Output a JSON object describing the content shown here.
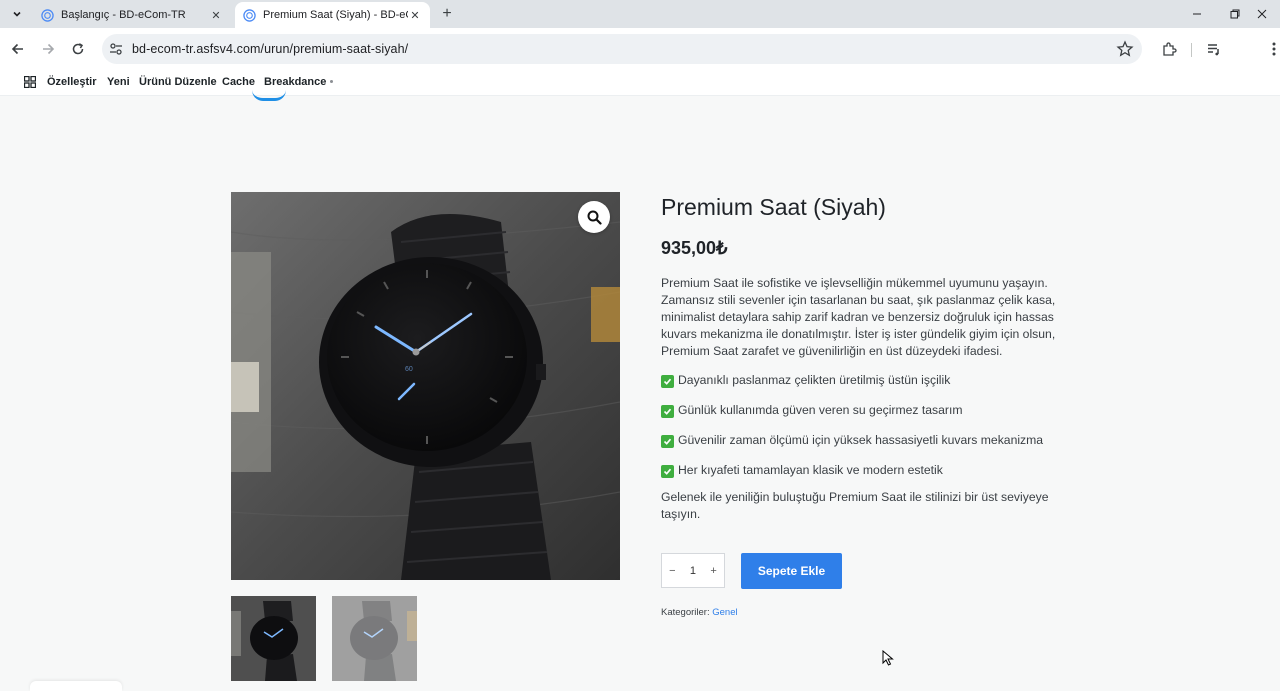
{
  "browser": {
    "tabs": [
      {
        "title": "Başlangıç - BD-eCom-TR",
        "active": false
      },
      {
        "title": "Premium Saat (Siyah) - BD-eCom-TR",
        "active": true
      }
    ],
    "url": "bd-ecom-tr.asfsv4.com/urun/premium-saat-siyah/"
  },
  "admin_bar": {
    "items": [
      "Özelleştir",
      "Yeni",
      "Ürünü Düzenle",
      "Cache",
      "Breakdance"
    ]
  },
  "product": {
    "title": "Premium Saat (Siyah)",
    "price": "935,00₺",
    "description": "Premium Saat ile sofistike ve işlevselliğin mükemmel uyumunu yaşayın. Zamansız stili sevenler için tasarlanan bu saat, şık paslanmaz çelik kasa, minimalist detaylara sahip zarif kadran ve benzersiz doğruluk için hassas kuvars mekanizma ile donatılmıştır. İster iş ister gündelik giyim için olsun, Premium Saat zarafet ve güvenilirliğin en üst düzeydeki ifadesi.",
    "features": [
      "Dayanıklı paslanmaz çelikten üretilmiş üstün işçilik",
      "Günlük kullanımda güven veren su geçirmez tasarım",
      "Güvenilir zaman ölçümü için yüksek hassasiyetli kuvars mekanizma",
      "Her kıyafeti tamamlayan klasik ve modern estetik"
    ],
    "closing": "Gelenek ile yeniliğin buluştuğu Premium Saat ile stilinizi bir üst seviyeye taşıyın.",
    "quantity": "1",
    "qty_minus": "−",
    "qty_plus": "+",
    "add_to_cart": "Sepete Ekle",
    "categories_label": "Kategoriler:",
    "category": "Genel",
    "watch_dial_text": "60"
  },
  "colors": {
    "accent": "#2f7fe9",
    "check": "#3fae3f"
  }
}
